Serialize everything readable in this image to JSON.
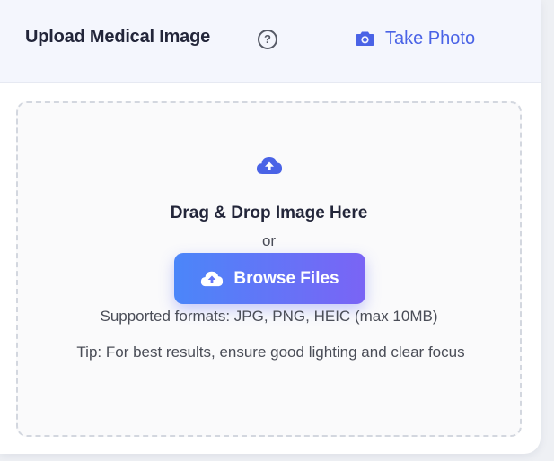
{
  "header": {
    "title": "Upload Medical Image",
    "help_icon": "question-circle-icon",
    "help_symbol": "?",
    "take_photo_label": "Take Photo",
    "take_photo_icon": "camera-icon"
  },
  "dropzone": {
    "icon": "cloud-upload-icon",
    "heading": "Drag & Drop Image Here",
    "or_text": "or",
    "browse_label": "Browse Files",
    "browse_icon": "cloud-upload-icon",
    "formats_text": "Supported formats: JPG, PNG, HEIC (max 10MB)",
    "tip_text": "Tip: For best results, ensure good lighting and clear focus"
  },
  "colors": {
    "accent": "#4a63e6",
    "button_gradient_start": "#4b86f9",
    "button_gradient_end": "#7a64f5",
    "header_bg": "#f4f6fd",
    "text_dark": "#23263a",
    "text_muted": "#4a4d57"
  }
}
